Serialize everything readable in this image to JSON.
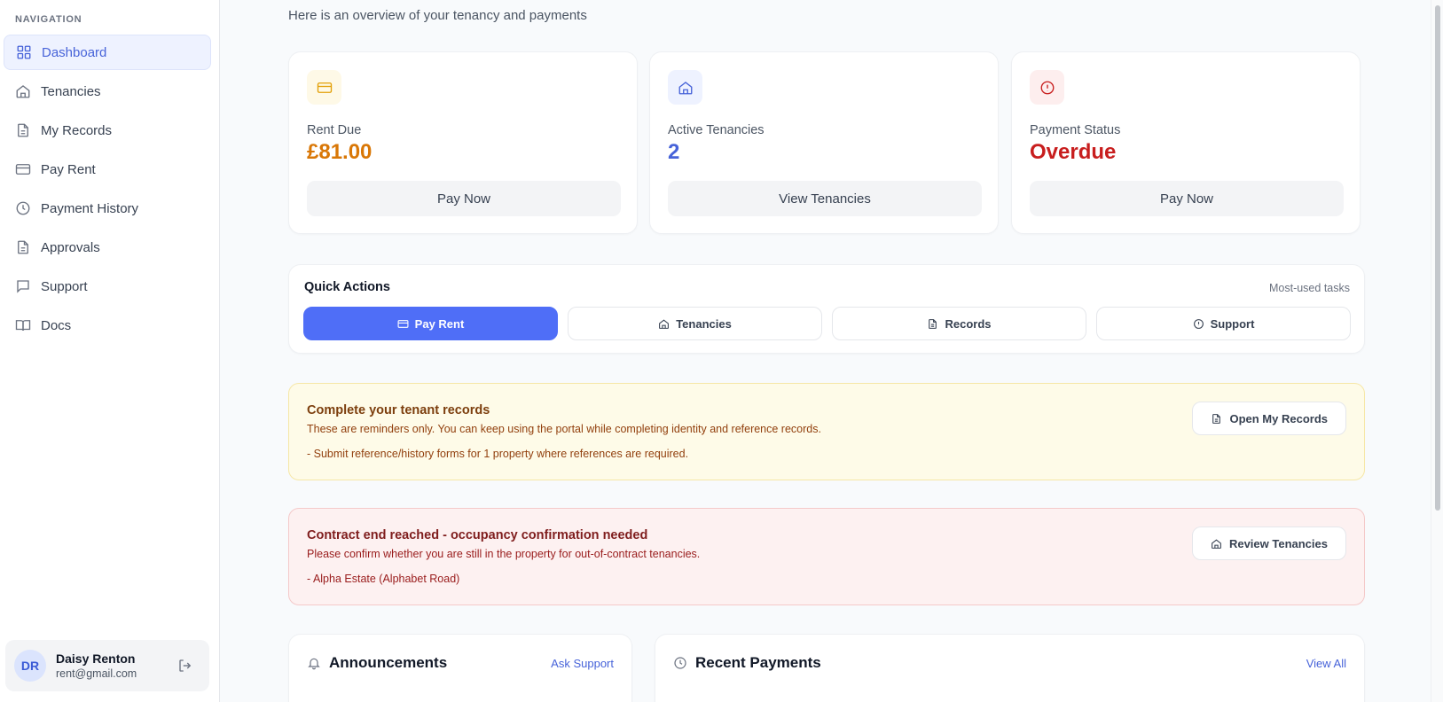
{
  "sidebar": {
    "nav_title": "NAVIGATION",
    "items": [
      {
        "label": "Dashboard",
        "icon": "grid-icon"
      },
      {
        "label": "Tenancies",
        "icon": "home-icon"
      },
      {
        "label": "My Records",
        "icon": "document-icon"
      },
      {
        "label": "Pay Rent",
        "icon": "credit-card-icon"
      },
      {
        "label": "Payment History",
        "icon": "clock-icon"
      },
      {
        "label": "Approvals",
        "icon": "document-icon"
      },
      {
        "label": "Support",
        "icon": "message-icon"
      },
      {
        "label": "Docs",
        "icon": "book-icon"
      }
    ],
    "active_item": "Dashboard",
    "user": {
      "initials": "DR",
      "name": "Daisy Renton",
      "email": "rent@gmail.com"
    }
  },
  "header": {
    "subtitle": "Here is an overview of your tenancy and payments"
  },
  "stats": [
    {
      "label": "Rent Due",
      "value": "£81.00",
      "button": "Pay Now",
      "icon": "credit-card-icon",
      "color": "#d97706",
      "icon_bg": "#fef9e7"
    },
    {
      "label": "Active Tenancies",
      "value": "2",
      "button": "View Tenancies",
      "icon": "home-icon",
      "color": "#4763d9",
      "icon_bg": "#eef2ff"
    },
    {
      "label": "Payment Status",
      "value": "Overdue",
      "button": "Pay Now",
      "icon": "alert-circle-icon",
      "color": "#c81e1e",
      "icon_bg": "#fdeeee"
    }
  ],
  "quick_actions": {
    "title": "Quick Actions",
    "hint": "Most-used tasks",
    "buttons": [
      {
        "label": "Pay Rent",
        "icon": "credit-card-icon"
      },
      {
        "label": "Tenancies",
        "icon": "home-icon"
      },
      {
        "label": "Records",
        "icon": "document-icon"
      },
      {
        "label": "Support",
        "icon": "alert-circle-icon"
      }
    ]
  },
  "alerts": {
    "records": {
      "title": "Complete your tenant records",
      "text": "These are reminders only. You can keep using the portal while completing identity and reference records.",
      "item": "- Submit reference/history forms for 1 property where references are required.",
      "button": "Open My Records"
    },
    "contract": {
      "title": "Contract end reached - occupancy confirmation needed",
      "text": "Please confirm whether you are still in the property for out-of-contract tenancies.",
      "item": "- Alpha Estate (Alphabet Road)",
      "button": "Review Tenancies"
    }
  },
  "announcements": {
    "title": "Announcements",
    "link": "Ask Support"
  },
  "recent_payments": {
    "title": "Recent Payments",
    "link": "View All"
  },
  "colors": {
    "primary": "#4f6ef7",
    "accent_text": "#4763d9"
  }
}
